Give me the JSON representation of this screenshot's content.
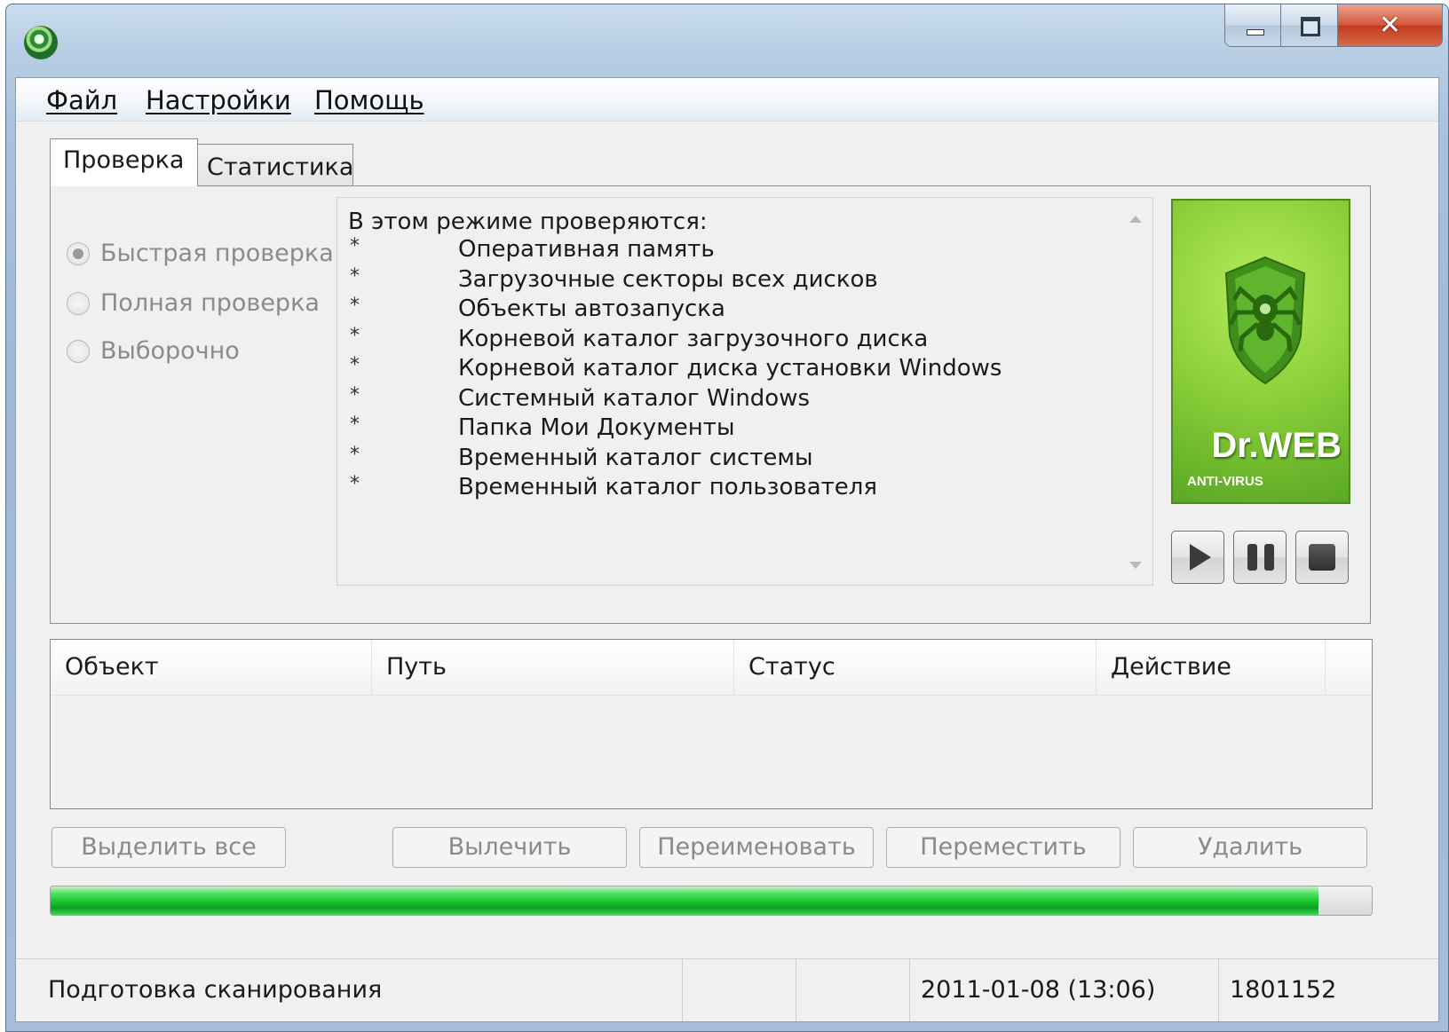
{
  "window": {
    "title": ""
  },
  "menu": [
    "Файл",
    "Настройки",
    "Помощь"
  ],
  "tabs": [
    "Проверка",
    "Статистика"
  ],
  "scan_modes": [
    {
      "label": "Быстрая проверка",
      "selected": true
    },
    {
      "label": "Полная проверка",
      "selected": false
    },
    {
      "label": "Выборочно",
      "selected": false
    }
  ],
  "description": {
    "heading": "В этом режиме проверяются:",
    "bullet": "*",
    "items": [
      "Оперативная память",
      "Загрузочные секторы всех дисков",
      "Объекты автозапуска",
      "Корневой каталог загрузочного диска",
      "Корневой каталог диска установки Windows",
      "Системный каталог Windows",
      "Папка Мои Документы",
      "Временный каталог системы",
      "Временный каталог пользователя"
    ]
  },
  "logo": {
    "title": "Dr.WEB",
    "subtitle": "ANTI-VIRUS"
  },
  "controls": {
    "play_icon": "play-icon",
    "pause_icon": "pause-icon",
    "stop_icon": "stop-icon"
  },
  "table": {
    "columns": [
      "Объект",
      "Путь",
      "Статус",
      "Действие"
    ],
    "rows": []
  },
  "actions": [
    "Выделить все",
    "Вылечить",
    "Переименовать",
    "Переместить",
    "Удалить"
  ],
  "progress": {
    "fraction": 0.96
  },
  "status": {
    "text": "Подготовка сканирования",
    "empty1": "",
    "empty2": "",
    "date": "2011-01-08 (13:06)",
    "count": "1801152"
  },
  "colors": {
    "accent_green": "#5aa825",
    "progress_green": "#15c32a",
    "close_red": "#c23a1e"
  }
}
